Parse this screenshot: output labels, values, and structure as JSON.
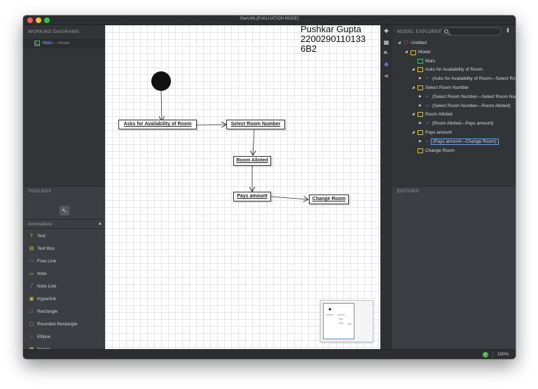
{
  "window": {
    "title": "StarUML(EVALUATION MODE)"
  },
  "working_diagrams": {
    "header": "WORKING DIAGRAMS",
    "items": [
      {
        "name": "Main",
        "sub": "— Model",
        "icon": "class-diagram-icon"
      }
    ]
  },
  "toolbox": {
    "header": "TOOLBOX",
    "section": "Annotations",
    "tools": [
      {
        "label": "Text",
        "icon": "text-icon",
        "glyph": "T"
      },
      {
        "label": "Text Box",
        "icon": "text-box-icon",
        "glyph": "▤"
      },
      {
        "label": "Free Line",
        "icon": "free-line-icon",
        "glyph": "〰"
      },
      {
        "label": "Note",
        "icon": "note-icon",
        "glyph": "▭"
      },
      {
        "label": "Note Link",
        "icon": "note-link-icon",
        "glyph": "╱"
      },
      {
        "label": "Hyperlink",
        "icon": "hyperlink-icon",
        "glyph": "▣"
      },
      {
        "label": "Rectangle",
        "icon": "rectangle-icon",
        "glyph": "□"
      },
      {
        "label": "Rounded Rectangle",
        "icon": "rounded-rectangle-icon",
        "glyph": "▢"
      },
      {
        "label": "Ellipse",
        "icon": "ellipse-icon",
        "glyph": "○"
      },
      {
        "label": "Image",
        "icon": "image-icon",
        "glyph": "▩"
      }
    ]
  },
  "diagram": {
    "author_lines": [
      "Pushkar Gupta",
      "2200290110133",
      "6B2"
    ],
    "nodes": {
      "asks": "Asks for Availability of Room",
      "select": "Select Room Number",
      "alloted": "Room Alloted",
      "pays": "Pays amount",
      "change": "Change Room"
    }
  },
  "model_explorer": {
    "header": "MODEL EXPLORER",
    "tree": [
      {
        "label": "Untitled",
        "icon": "project-icon"
      },
      {
        "label": "Model",
        "icon": "model-folder-icon"
      },
      {
        "label": "Main",
        "icon": "class-diagram-icon"
      },
      {
        "label": "Asks for Availability of Room",
        "icon": "class-icon"
      },
      {
        "label": "(Asks for Availability of Room—Select Room Number)",
        "icon": "association-icon"
      },
      {
        "label": "Select Room Number",
        "icon": "class-icon"
      },
      {
        "label": "(Select Room Number—Select Room Number)",
        "icon": "association-icon"
      },
      {
        "label": "(Select Room Number—Room Alloted)",
        "icon": "association-icon"
      },
      {
        "label": "Room Alloted",
        "icon": "class-icon"
      },
      {
        "label": "(Room Alloted—Pays amount)",
        "icon": "association-icon"
      },
      {
        "label": "Pays amount",
        "icon": "class-icon"
      },
      {
        "label": "(Pays amount—Change Room)",
        "icon": "association-icon"
      },
      {
        "label": "Change Room",
        "icon": "class-icon"
      }
    ]
  },
  "editors": {
    "header": "EDITORS"
  },
  "status": {
    "zoom": "100%"
  },
  "colors": {
    "accent": "#6d9ef5",
    "ok": "#4caf50",
    "panel": "#3b3e42",
    "class_icon": "#d9b84a"
  }
}
